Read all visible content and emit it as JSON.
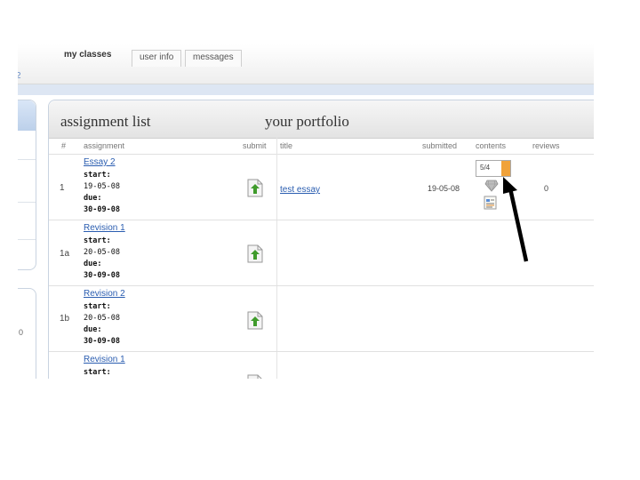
{
  "tabs": [
    {
      "label": "my classes",
      "active": true
    },
    {
      "label": "user info",
      "active": false
    },
    {
      "label": "messages",
      "active": false
    }
  ],
  "nav_marker": "2",
  "side_label": "0",
  "panel": {
    "title_left": "assignment list",
    "title_right": "your portfolio"
  },
  "columns": {
    "num": "#",
    "assignment": "assignment",
    "submit": "submit",
    "title": "title",
    "submitted": "submitted",
    "contents": "contents",
    "reviews": "reviews"
  },
  "rows": [
    {
      "number": "1",
      "name": "Essay 2",
      "start_label": "start:",
      "start": "19-05-08",
      "due_label": "due:",
      "due": "30-09-08",
      "file_title": "test essay",
      "submitted": "19-05-08",
      "word_count": "5/4",
      "reviews": "0"
    },
    {
      "number": "1a",
      "name": "Revision 1",
      "start_label": "start:",
      "start": "20-05-08",
      "due_label": "due:",
      "due": "30-09-08"
    },
    {
      "number": "1b",
      "name": "Revision 2",
      "start_label": "start:",
      "start": "20-05-08",
      "due_label": "due:",
      "due": "30-09-08"
    },
    {
      "name": "Revision 1",
      "start_label": "start:"
    }
  ],
  "colors": {
    "link": "#2a5db0",
    "accent_orange": "#f0a23a",
    "upload_green": "#3f9b2b",
    "panel_blue": "#bcd0ea"
  },
  "icons": {
    "upload": "upload-arrow-icon",
    "gem": "gem-icon",
    "document": "document-icon",
    "annotation": "pointer-arrow-icon"
  }
}
